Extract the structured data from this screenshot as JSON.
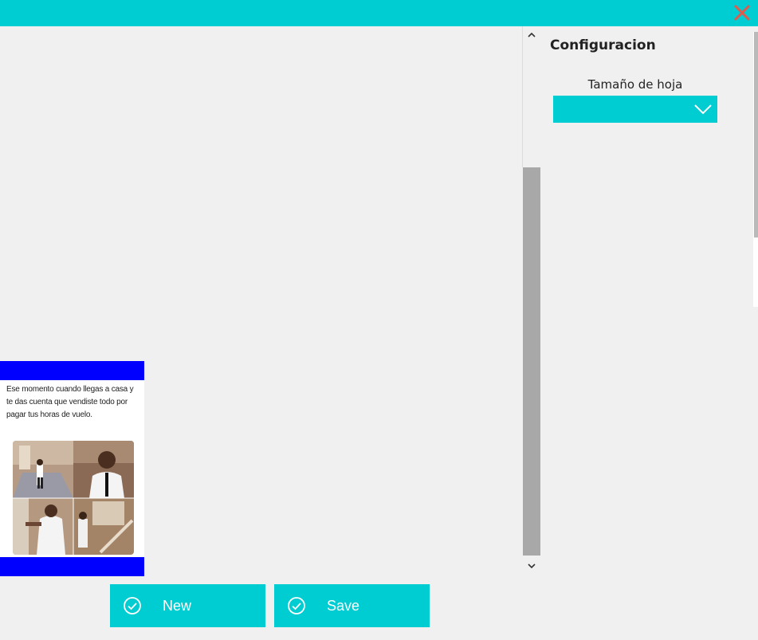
{
  "window": {
    "close_label": "close"
  },
  "panel": {
    "title": "Configuracion",
    "size_label": "Tamaño de hoja",
    "size_value": ""
  },
  "card": {
    "caption": "Ese momento cuando llegas a casa y te das cuenta que vendiste todo por pagar tus horas de vuelo."
  },
  "buttons": {
    "new_label": "New",
    "save_label": "Save"
  },
  "colors": {
    "accent": "#00cdd1",
    "close": "#e05a4e",
    "card_band": "#0000ff",
    "scroll_thumb": "#a8a8a8"
  }
}
